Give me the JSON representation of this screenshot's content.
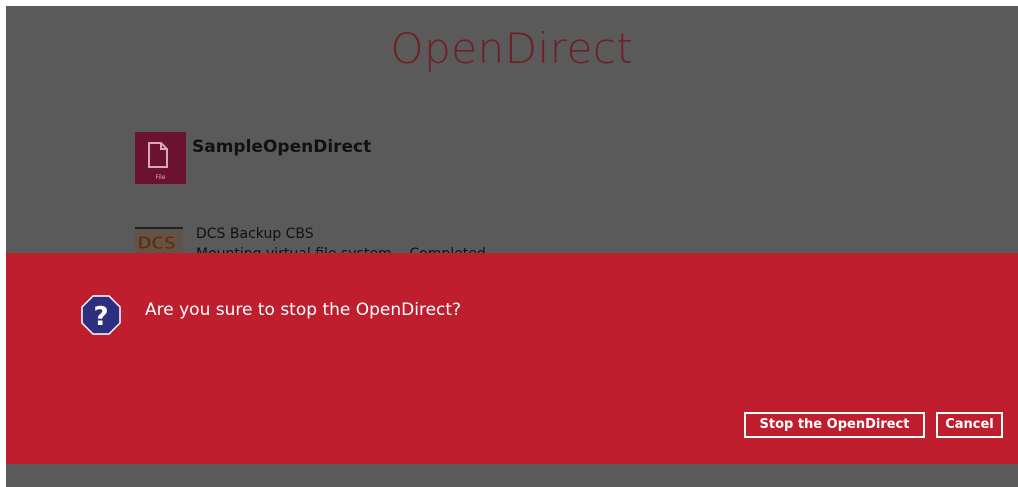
{
  "page": {
    "title": "OpenDirect"
  },
  "file_item": {
    "name": "SampleOpenDirect",
    "icon": "file-icon",
    "icon_caption": "File"
  },
  "destination": {
    "logo": "DCS",
    "name": "DCS Backup CBS",
    "status": "Mounting virtual file system... Completed"
  },
  "dialog": {
    "icon": "question-icon",
    "message": "Are you sure to stop the OpenDirect?",
    "confirm_label": "Stop the OpenDirect",
    "cancel_label": "Cancel",
    "background_color": "#be1e2d"
  },
  "colors": {
    "overlay": "#5a5a5a",
    "accent": "#6b1230"
  }
}
